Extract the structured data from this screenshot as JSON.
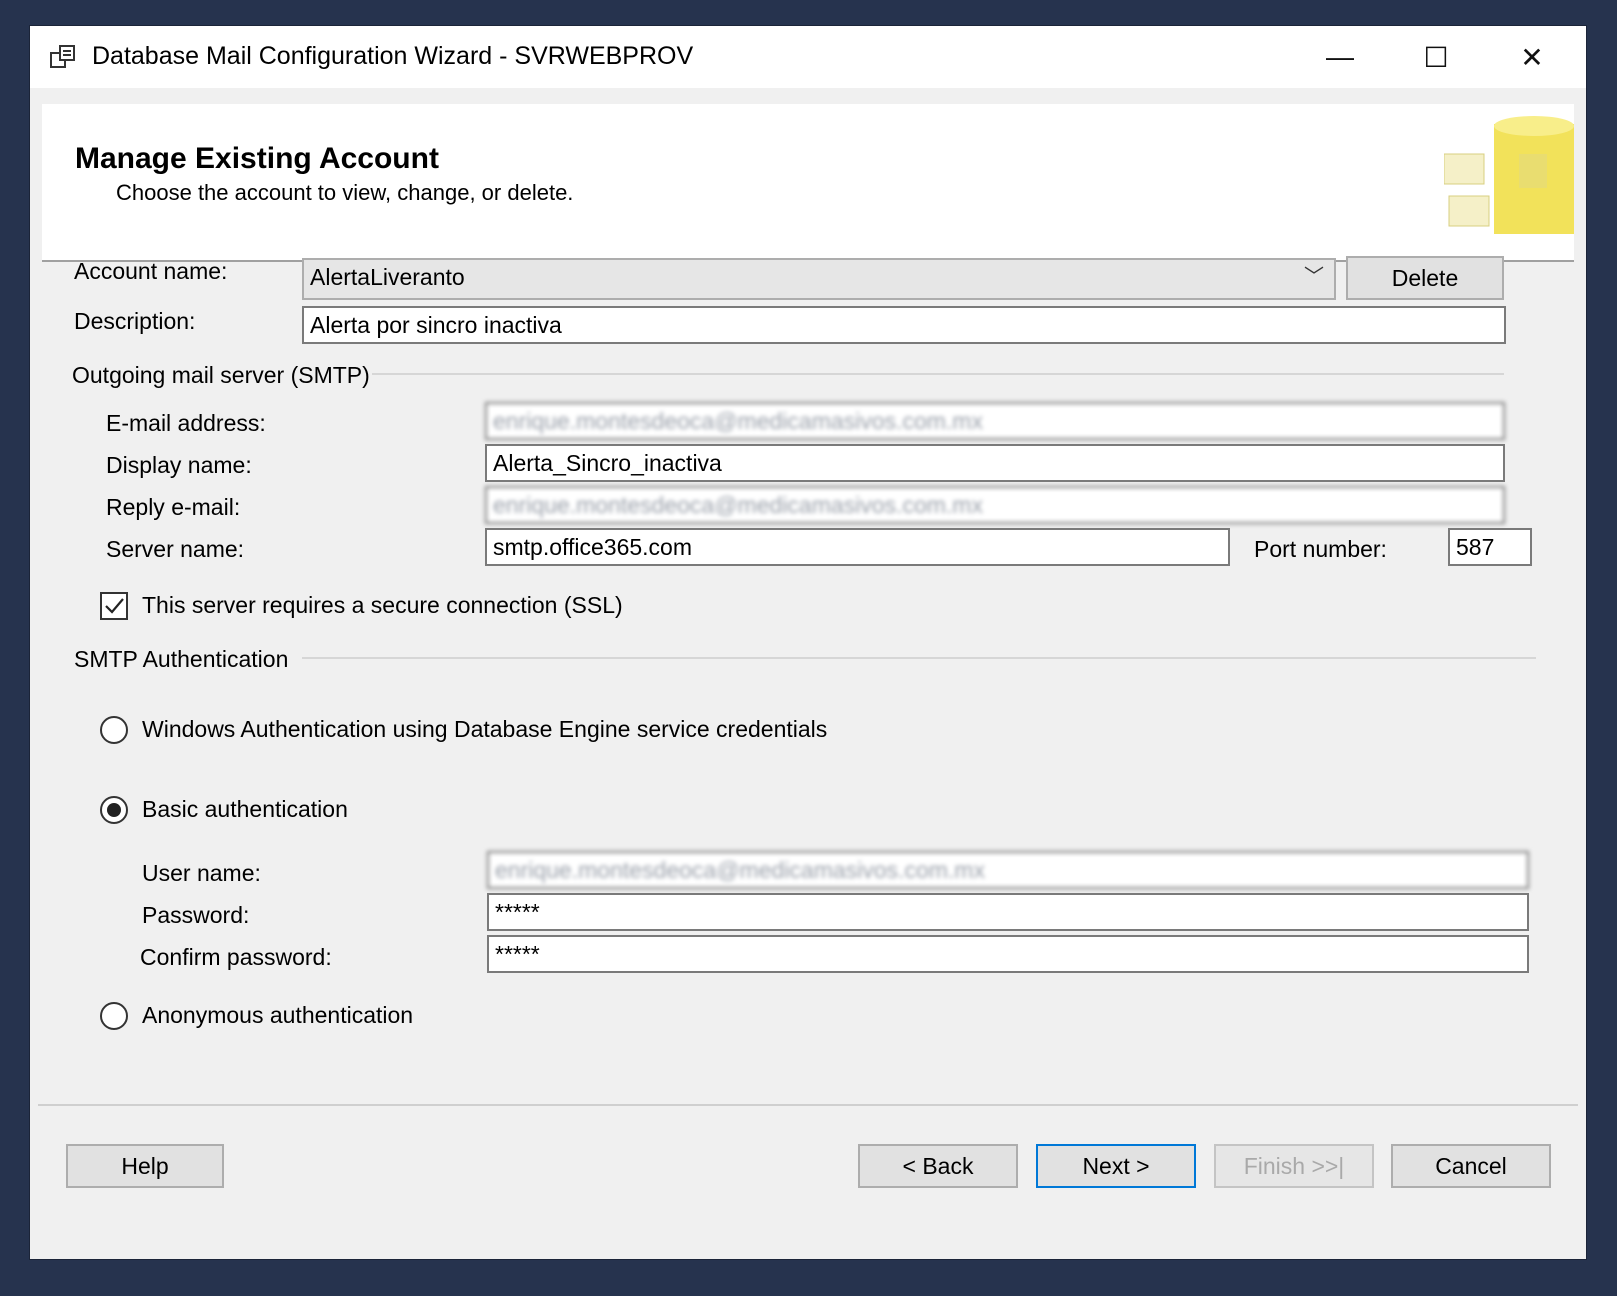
{
  "window": {
    "title": "Database Mail Configuration Wizard - SVRWEBPROV",
    "minimize_glyph": "—",
    "maximize_glyph": "☐",
    "close_glyph": "✕"
  },
  "header": {
    "title": "Manage Existing Account",
    "subtitle": "Choose the account to view, change, or delete."
  },
  "account": {
    "name_label": "Account name:",
    "name_value": "AlertaLiveranto",
    "delete_label": "Delete",
    "description_label": "Description:",
    "description_value": "Alerta por sincro inactiva"
  },
  "smtp": {
    "group_label": "Outgoing mail server (SMTP)",
    "email_label": "E-mail address:",
    "email_value": "enrique.montesdeoca@medicamasivos.com.mx",
    "display_label": "Display name:",
    "display_value": "Alerta_Sincro_inactiva",
    "reply_label": "Reply e-mail:",
    "reply_value": "enrique.montesdeoca@medicamasivos.com.mx",
    "server_label": "Server name:",
    "server_value": "smtp.office365.com",
    "port_label": "Port number:",
    "port_value": "587",
    "ssl_label": "This server requires a secure connection (SSL)",
    "ssl_checked": true
  },
  "auth": {
    "group_label": "SMTP Authentication",
    "windows_label": "Windows Authentication using Database Engine service credentials",
    "basic_label": "Basic authentication",
    "user_label": "User name:",
    "user_value": "enrique.montesdeoca@medicamasivos.com.mx",
    "password_label": "Password:",
    "password_value": "*****",
    "confirm_label": "Confirm password:",
    "confirm_value": "*****",
    "anonymous_label": "Anonymous authentication",
    "selected": "basic"
  },
  "footer": {
    "help": "Help",
    "back": "< Back",
    "next": "Next >",
    "finish": "Finish >>|",
    "cancel": "Cancel"
  },
  "colors": {
    "desktop": "#26334e",
    "dialog": "#f0f0f0",
    "focus_border": "#0078d7"
  }
}
